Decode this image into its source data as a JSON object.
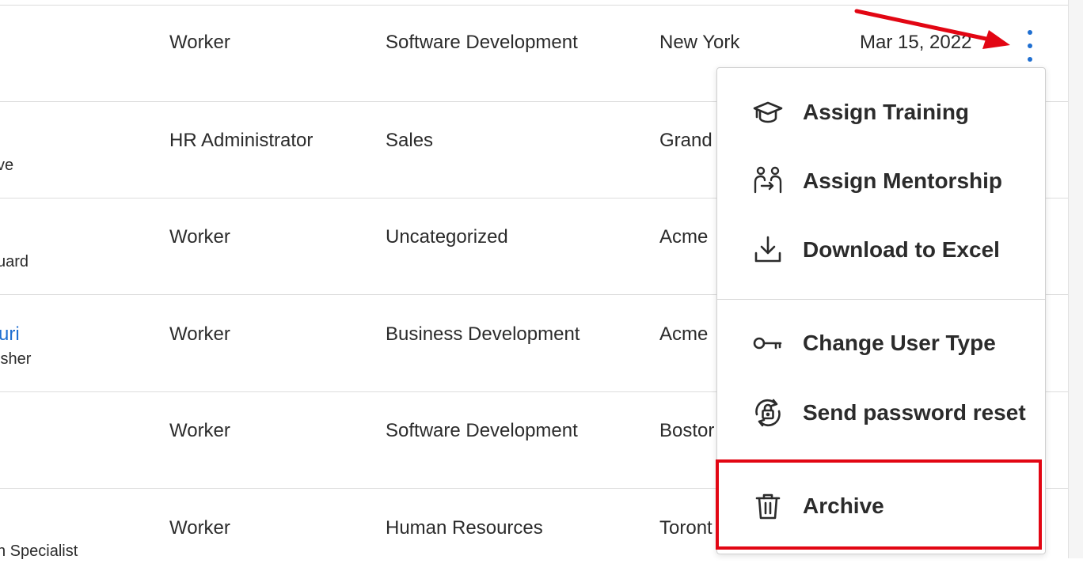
{
  "rows": [
    {
      "name": "",
      "sub": "",
      "type": "Worker",
      "department": "Software Development",
      "location": "New York",
      "date": "Mar 15, 2022"
    },
    {
      "name": "",
      "sub": "ve",
      "type": "HR Administrator",
      "department": "Sales",
      "location": "Grand",
      "date": ""
    },
    {
      "name": "",
      "sub": "uard",
      "type": "Worker",
      "department": "Uncategorized",
      "location": "Acme",
      "date": ""
    },
    {
      "name": "uri",
      "sub": "isher",
      "type": "Worker",
      "department": "Business Development",
      "location": "Acme",
      "date": ""
    },
    {
      "name": "",
      "sub": "",
      "type": "Worker",
      "department": "Software Development",
      "location": "Bostor",
      "date": ""
    },
    {
      "name": "",
      "sub": "n Specialist",
      "type": "Worker",
      "department": "Human Resources",
      "location": "Toront",
      "date": ""
    }
  ],
  "menu": {
    "items": [
      {
        "label": "Assign Training",
        "icon": "graduation-cap-icon"
      },
      {
        "label": "Assign Mentorship",
        "icon": "mentorship-icon"
      },
      {
        "label": "Download to Excel",
        "icon": "download-icon"
      },
      {
        "label": "Change User Type",
        "icon": "key-icon"
      },
      {
        "label": "Send password reset",
        "icon": "lock-reset-icon"
      },
      {
        "label": "Archive",
        "icon": "trash-icon"
      }
    ]
  },
  "colors": {
    "accent": "#1f6fd1",
    "annotation": "#e20613",
    "text": "#2b2b2b"
  }
}
